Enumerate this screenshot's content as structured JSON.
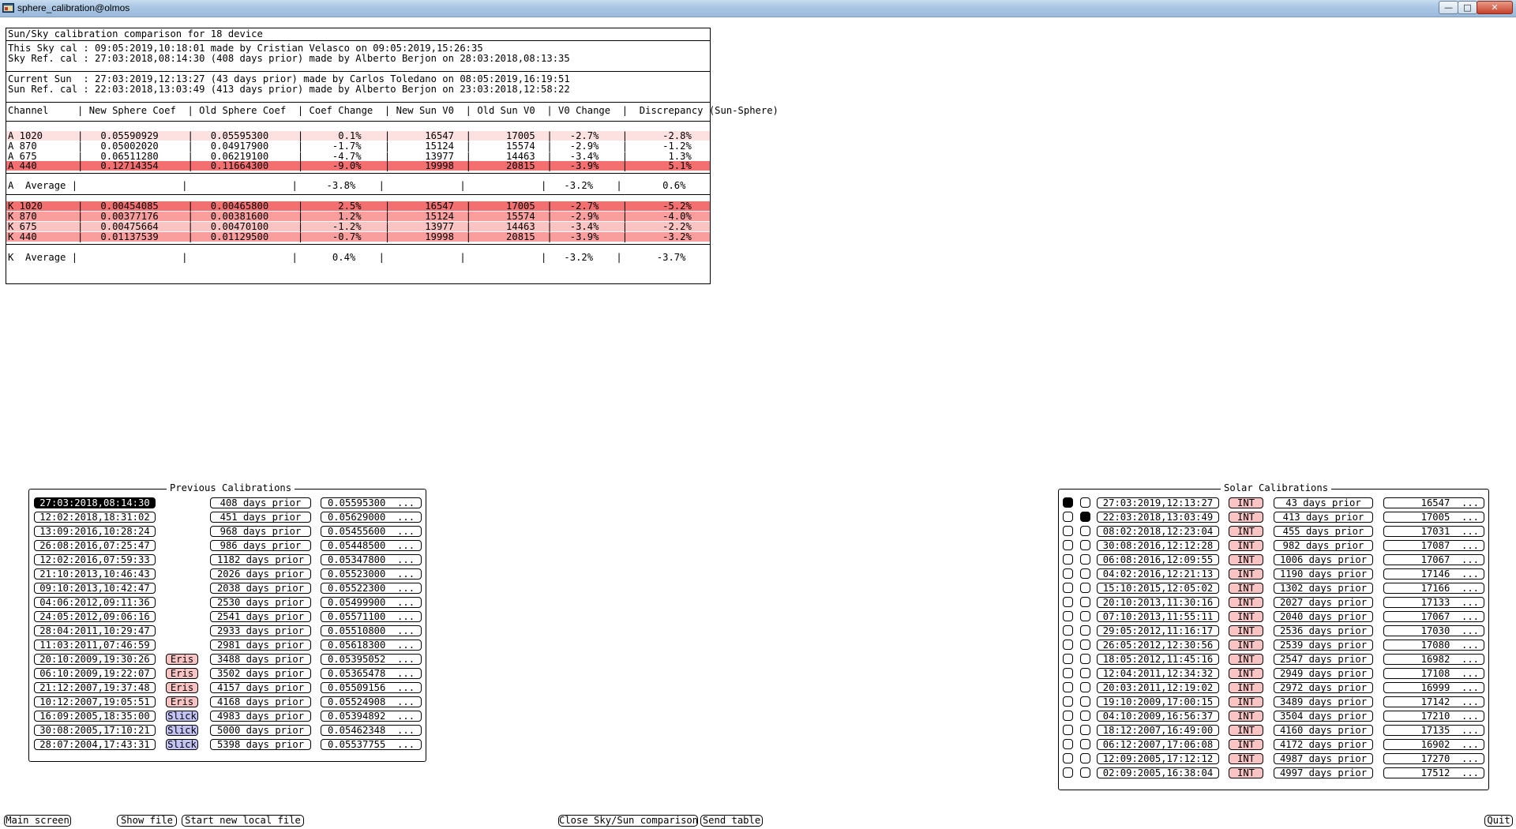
{
  "window": {
    "title": "sphere_calibration@olmos"
  },
  "report": {
    "header": "Sun/Sky calibration comparison for 18 device",
    "sky_cal_line": "This Sky cal : 09:05:2019,10:18:01 made by Cristian Velasco on 09:05:2019,15:26:35",
    "sky_ref_line": "Sky Ref. cal : 27:03:2018,08:14:30 (408 days prior) made by Alberto Berjon on 28:03:2018,08:13:35",
    "current_sun_line": "Current Sun  : 27:03:2019,12:13:27 (43 days prior) made by Carlos Toledano on 08:05:2019,16:19:51",
    "sun_ref_line": "Sun Ref. cal : 22:03:2018,13:03:49 (413 days prior) made by Alberto Berjon on 23:03:2018,12:58:22",
    "table_header": "Channel     | New Sphere Coef  | Old Sphere Coef  | Coef Change  | New Sun V0  | Old Sun V0  | V0 Change  |  Discrepancy (Sun-Sphere)",
    "a_rows": [
      {
        "text": "A 1020      |   0.05590929     |   0.05595300     |      0.1%    |      16547  |      17005  |   -2.7%    |      -2.8%",
        "color": "#fde0e0"
      },
      {
        "text": "A 870       |   0.05002020     |   0.04917900     |     -1.7%    |      15124  |      15574  |   -2.9%    |      -1.2%",
        "color": "#ffffff"
      },
      {
        "text": "A 675       |   0.06511280     |   0.06219100     |     -4.7%    |      13977  |      14463  |   -3.4%    |       1.3%",
        "color": "#ffffff"
      },
      {
        "text": "A 440       |   0.12714354     |   0.11664300     |     -9.0%    |      19998  |      20815  |   -3.9%    |       5.1%",
        "color": "#f46f6f"
      }
    ],
    "a_average": "A  Average |                  |                  |     -3.8%    |             |             |   -3.2%    |       0.6%",
    "k_rows": [
      {
        "text": "K 1020      |   0.00454085     |   0.00465800     |      2.5%    |      16547  |      17005  |   -2.7%    |      -5.2%",
        "color": "#f46f6f"
      },
      {
        "text": "K 870       |   0.00377176     |   0.00381600     |      1.2%    |      15124  |      15574  |   -2.9%    |      -4.0%",
        "color": "#f99d9d"
      },
      {
        "text": "K 675       |   0.00475664     |   0.00470100     |     -1.2%    |      13977  |      14463  |   -3.4%    |      -2.2%",
        "color": "#fcc3c3"
      },
      {
        "text": "K 440       |   0.01137539     |   0.01129500     |     -0.7%    |      19998  |      20815  |   -3.9%    |      -3.2%",
        "color": "#f99d9d"
      }
    ],
    "k_average": "K  Average |                  |                  |      0.4%    |             |             |   -3.2%    |      -3.7%"
  },
  "previous": {
    "title": "Previous Calibrations",
    "rows": [
      {
        "date": "27:03:2018,08:14:30",
        "tag": "",
        "days": "408 days prior",
        "coef": "0.05595300  ...",
        "selected": true
      },
      {
        "date": "12:02:2018,18:31:02",
        "tag": "",
        "days": "451 days prior",
        "coef": "0.05629000  ...",
        "selected": false
      },
      {
        "date": "13:09:2016,10:28:24",
        "tag": "",
        "days": "968 days prior",
        "coef": "0.05455600  ...",
        "selected": false
      },
      {
        "date": "26:08:2016,07:25:47",
        "tag": "",
        "days": "986 days prior",
        "coef": "0.05448500  ...",
        "selected": false
      },
      {
        "date": "12:02:2016,07:59:33",
        "tag": "",
        "days": "1182 days prior",
        "coef": "0.05347800  ...",
        "selected": false
      },
      {
        "date": "21:10:2013,10:46:43",
        "tag": "",
        "days": "2026 days prior",
        "coef": "0.05523000  ...",
        "selected": false
      },
      {
        "date": "09:10:2013,10:42:47",
        "tag": "",
        "days": "2038 days prior",
        "coef": "0.05522300  ...",
        "selected": false
      },
      {
        "date": "04:06:2012,09:11:36",
        "tag": "",
        "days": "2530 days prior",
        "coef": "0.05499900  ...",
        "selected": false
      },
      {
        "date": "24:05:2012,09:06:16",
        "tag": "",
        "days": "2541 days prior",
        "coef": "0.05571100  ...",
        "selected": false
      },
      {
        "date": "28:04:2011,10:29:47",
        "tag": "",
        "days": "2933 days prior",
        "coef": "0.05510800  ...",
        "selected": false
      },
      {
        "date": "11:03:2011,07:46:59",
        "tag": "",
        "days": "2981 days prior",
        "coef": "0.05618300  ...",
        "selected": false
      },
      {
        "date": "20:10:2009,19:30:26",
        "tag": "Eris",
        "days": "3488 days prior",
        "coef": "0.05395052  ...",
        "selected": false
      },
      {
        "date": "06:10:2009,19:22:07",
        "tag": "Eris",
        "days": "3502 days prior",
        "coef": "0.05365478  ...",
        "selected": false
      },
      {
        "date": "21:12:2007,19:37:48",
        "tag": "Eris",
        "days": "4157 days prior",
        "coef": "0.05509156  ...",
        "selected": false
      },
      {
        "date": "10:12:2007,19:05:51",
        "tag": "Eris",
        "days": "4168 days prior",
        "coef": "0.05524908  ...",
        "selected": false
      },
      {
        "date": "16:09:2005,18:35:00",
        "tag": "Slick",
        "days": "4983 days prior",
        "coef": "0.05394892  ...",
        "selected": false
      },
      {
        "date": "30:08:2005,17:10:21",
        "tag": "Slick",
        "days": "5000 days prior",
        "coef": "0.05462348  ...",
        "selected": false
      },
      {
        "date": "28:07:2004,17:43:31",
        "tag": "Slick",
        "days": "5398 days prior",
        "coef": "0.05537755  ...",
        "selected": false
      }
    ]
  },
  "solar": {
    "title": "Solar Calibrations",
    "rows": [
      {
        "r1": true,
        "r2": false,
        "date": "27:03:2019,12:13:27",
        "tag": "INT",
        "days": "43 days prior",
        "v0": "16547  ..."
      },
      {
        "r1": false,
        "r2": true,
        "date": "22:03:2018,13:03:49",
        "tag": "INT",
        "days": "413 days prior",
        "v0": "17005  ..."
      },
      {
        "r1": false,
        "r2": false,
        "date": "08:02:2018,12:23:04",
        "tag": "INT",
        "days": "455 days prior",
        "v0": "17031  ..."
      },
      {
        "r1": false,
        "r2": false,
        "date": "30:08:2016,12:12:28",
        "tag": "INT",
        "days": "982 days prior",
        "v0": "17087  ..."
      },
      {
        "r1": false,
        "r2": false,
        "date": "06:08:2016,12:09:55",
        "tag": "INT",
        "days": "1006 days prior",
        "v0": "17067  ..."
      },
      {
        "r1": false,
        "r2": false,
        "date": "04:02:2016,12:21:13",
        "tag": "INT",
        "days": "1190 days prior",
        "v0": "17146  ..."
      },
      {
        "r1": false,
        "r2": false,
        "date": "15:10:2015,12:05:02",
        "tag": "INT",
        "days": "1302 days prior",
        "v0": "17166  ..."
      },
      {
        "r1": false,
        "r2": false,
        "date": "20:10:2013,11:30:16",
        "tag": "INT",
        "days": "2027 days prior",
        "v0": "17133  ..."
      },
      {
        "r1": false,
        "r2": false,
        "date": "07:10:2013,11:55:11",
        "tag": "INT",
        "days": "2040 days prior",
        "v0": "17067  ..."
      },
      {
        "r1": false,
        "r2": false,
        "date": "29:05:2012,11:16:17",
        "tag": "INT",
        "days": "2536 days prior",
        "v0": "17030  ..."
      },
      {
        "r1": false,
        "r2": false,
        "date": "26:05:2012,12:30:56",
        "tag": "INT",
        "days": "2539 days prior",
        "v0": "17080  ..."
      },
      {
        "r1": false,
        "r2": false,
        "date": "18:05:2012,11:45:16",
        "tag": "INT",
        "days": "2547 days prior",
        "v0": "16982  ..."
      },
      {
        "r1": false,
        "r2": false,
        "date": "12:04:2011,12:34:32",
        "tag": "INT",
        "days": "2949 days prior",
        "v0": "17108  ..."
      },
      {
        "r1": false,
        "r2": false,
        "date": "20:03:2011,12:19:02",
        "tag": "INT",
        "days": "2972 days prior",
        "v0": "16999  ..."
      },
      {
        "r1": false,
        "r2": false,
        "date": "19:10:2009,17:00:15",
        "tag": "INT",
        "days": "3489 days prior",
        "v0": "17142  ..."
      },
      {
        "r1": false,
        "r2": false,
        "date": "04:10:2009,16:56:37",
        "tag": "INT",
        "days": "3504 days prior",
        "v0": "17210  ..."
      },
      {
        "r1": false,
        "r2": false,
        "date": "18:12:2007,16:49:00",
        "tag": "INT",
        "days": "4160 days prior",
        "v0": "17135  ..."
      },
      {
        "r1": false,
        "r2": false,
        "date": "06:12:2007,17:06:08",
        "tag": "INT",
        "days": "4172 days prior",
        "v0": "16902  ..."
      },
      {
        "r1": false,
        "r2": false,
        "date": "12:09:2005,17:12:12",
        "tag": "INT",
        "days": "4987 days prior",
        "v0": "17270  ..."
      },
      {
        "r1": false,
        "r2": false,
        "date": "02:09:2005,16:38:04",
        "tag": "INT",
        "days": "4997 days prior",
        "v0": "17512  ..."
      }
    ]
  },
  "buttons": {
    "main_screen": "Main screen",
    "show_file": "Show file",
    "start_new_local_file": "Start new local file",
    "close_comparison": "Close Sky/Sun comparison",
    "send_table": "Send table",
    "quit": "Quit"
  },
  "colors": {
    "pink_light": "#fde0e0",
    "pink_mid": "#fcc3c3",
    "pink_strong": "#f99d9d",
    "red": "#f46f6f",
    "eris_tag": "#fbc4c4",
    "slick_tag": "#c3c3f5",
    "int_tag": "#fbc4c4"
  }
}
